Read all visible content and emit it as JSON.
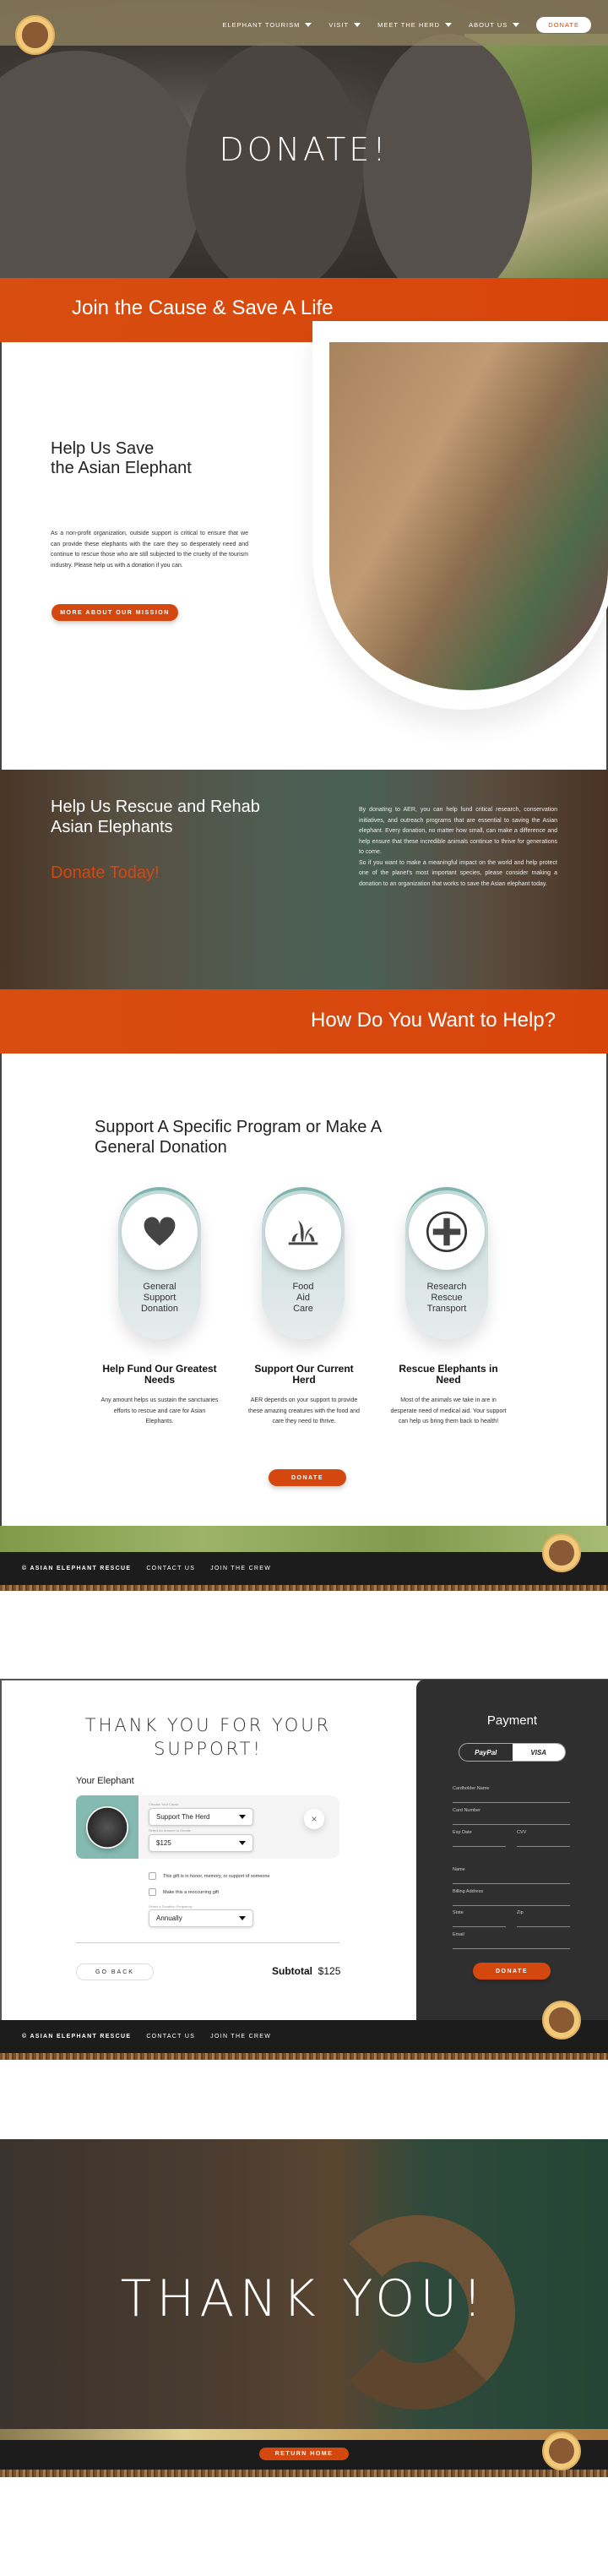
{
  "nav": {
    "items": [
      "ELEPHANT TOURISM",
      "VISIT",
      "MEET THE HERD",
      "ABOUT US"
    ],
    "donate": "DONATE"
  },
  "hero": {
    "title": "DONATE!"
  },
  "band1": "Join the Cause & Save A Life",
  "save": {
    "heading1": "Help Us Save",
    "heading2": "the Asian Elephant",
    "body": "As a non-profit organization, outside support is critical to ensure that we can provide these elephants with the care they so desperately need and continue to rescue those who are still subjected to the cruelty of the tourism industry.  Please help us with a donation if you can.",
    "button": "MORE ABOUT OUR MISSION"
  },
  "rescue": {
    "heading1": "Help Us Rescue and Rehab",
    "heading2": "Asian Elephants",
    "cta": "Donate Today!",
    "body1": "By donating to AER, you can help fund critical research, conservation initiatives, and outreach programs that are essential to saving the Asian elephant. Every donation, no matter how small, can make a difference and help ensure that these incredible animals continue to thrive for generations to come.",
    "body2": "So if you want to make a meaningful impact on the world and help protect one of the planet's most important species, please consider making a donation to an organization that works to save the Asian elephant today."
  },
  "band2": "How Do You Want to Help?",
  "programs": {
    "heading1": "Support A Specific Program or Make A",
    "heading2": "General Donation",
    "items": [
      {
        "icon": "heart-icon",
        "l1": "General",
        "l2": "Support",
        "l3": "Donation",
        "title": "Help Fund Our Greatest Needs",
        "body": "Any amount helps us sustain the sanctuaries efforts to rescue and care for Asian Elephants."
      },
      {
        "icon": "plant-icon",
        "l1": "Food",
        "l2": "Aid",
        "l3": "Care",
        "title": "Support Our Current Herd",
        "body": "AER depends on your support to provide these amazing creatures with the food and care they need to thrive."
      },
      {
        "icon": "medical-cross-icon",
        "l1": "Research",
        "l2": "Rescue",
        "l3": "Transport",
        "title": "Rescue Elephants in Need",
        "body": "Most of the animals we take in are in desperate need of medical aid.  Your support can help us bring them back to health!"
      }
    ],
    "button": "DONATE"
  },
  "footer": {
    "copyright": "© ASIAN ELEPHANT RESCUE",
    "contact": "CONTACT US",
    "join": "JOIN THE CREW"
  },
  "checkout": {
    "title1": "THANK YOU FOR YOUR",
    "title2": "SUPPORT!",
    "your_elephant": "Your Elephant",
    "cause_label": "Choose Your Cause",
    "cause": "Support The Herd",
    "amount_label": "Select An Amount to Donate",
    "amount": "$125",
    "check1": "This gift is in honor, memory, or support of someone",
    "check2": "Make this a reoccurring gift",
    "freq_label": "Select a Donation Frequency",
    "freq": "Annually",
    "go_back": "GO BACK",
    "subtotal_label": "Subtotal",
    "subtotal": "$125"
  },
  "payment": {
    "title": "Payment",
    "paypal": "PayPal",
    "visa": "VISA",
    "fields": [
      "Cardholder Name",
      "Card Number",
      "Exp Date",
      "CVV",
      "Name",
      "Billing Address",
      "State",
      "Zip",
      "Email"
    ],
    "button": "DONATE"
  },
  "thanks": {
    "title": "THANK YOU!",
    "button": "RETURN HOME"
  },
  "colors": {
    "accent": "#d4470e",
    "teal": "#7fb5ad",
    "dark": "#2f2f2f"
  }
}
